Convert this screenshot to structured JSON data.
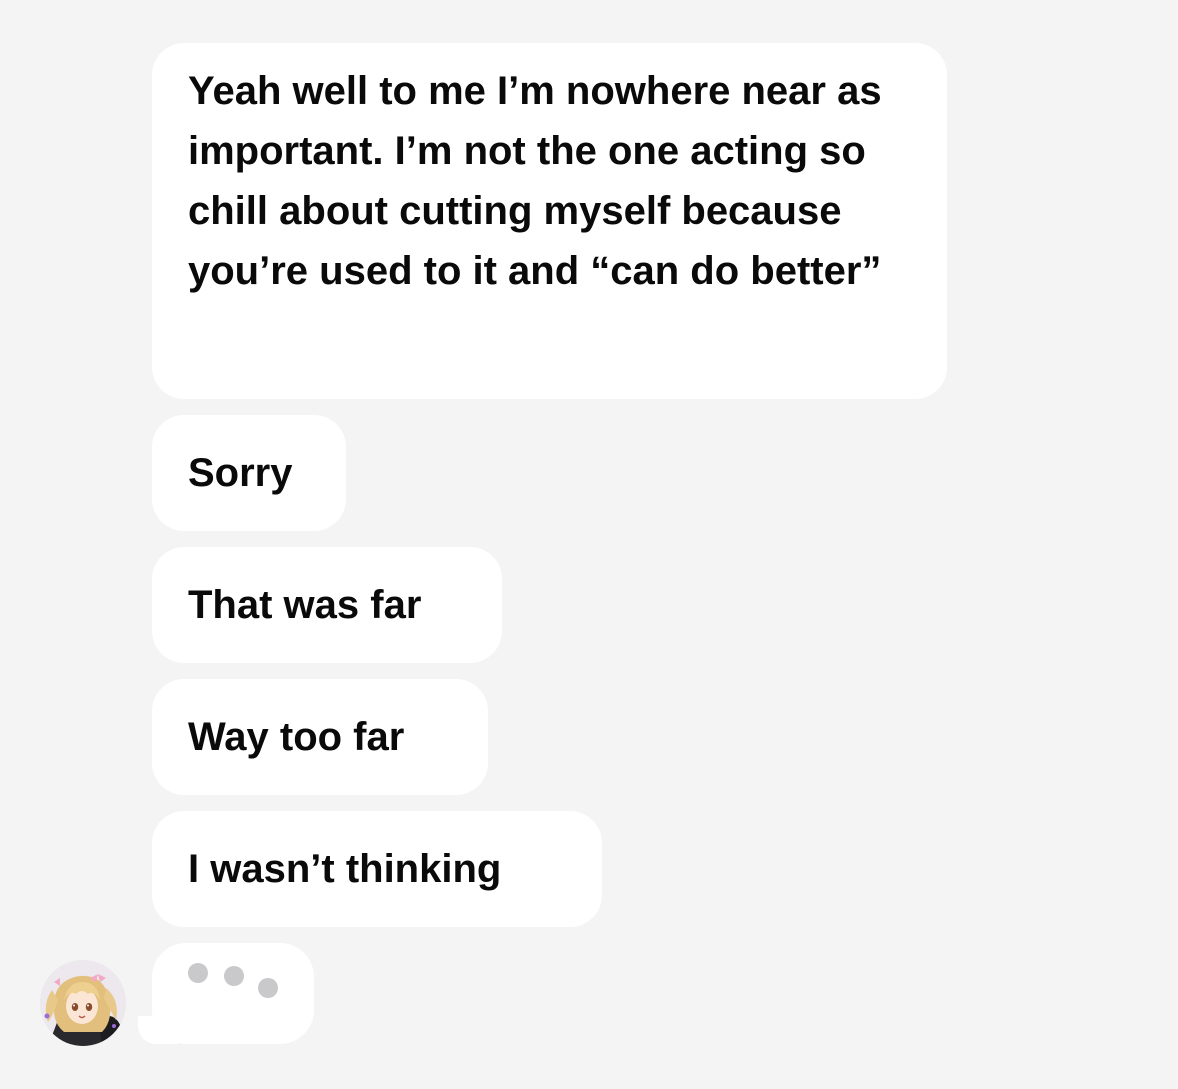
{
  "thread": {
    "messages": [
      {
        "text": "Yeah well to me I’m nowhere near as important. I’m not the one acting so chill about cutting myself because you’re used to it and “can do better”"
      },
      {
        "text": "Sorry"
      },
      {
        "text": "That was far"
      },
      {
        "text": "Way too far"
      },
      {
        "text": "I wasn’t thinking"
      }
    ],
    "typing_indicator": {
      "icon": "typing-dots-icon",
      "dot_color": "#c9c9cc"
    },
    "avatar": {
      "icon": "anime-girl-avatar"
    }
  },
  "colors": {
    "background": "#f4f4f4",
    "bubble": "#ffffff",
    "text": "#0a0a0a"
  }
}
